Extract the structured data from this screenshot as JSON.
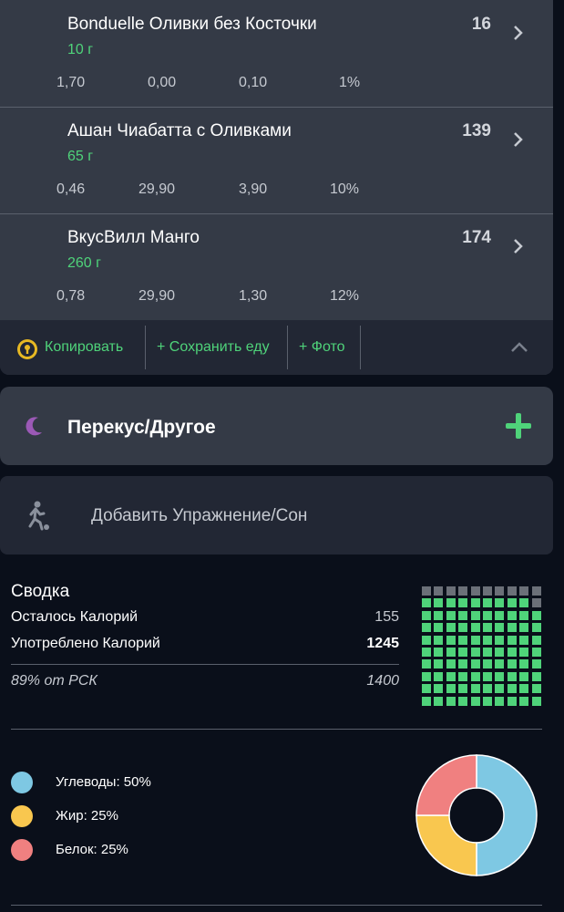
{
  "foods": [
    {
      "name": "Bonduelle Оливки без Косточки",
      "qty": "10 г",
      "kcal": "16",
      "n1": "1,70",
      "n2": "0,00",
      "n3": "0,10",
      "pct": "1%"
    },
    {
      "name": "Ашан Чиабатта с Оливками",
      "qty": "65 г",
      "kcal": "139",
      "n1": "0,46",
      "n2": "29,90",
      "n3": "3,90",
      "pct": "10%"
    },
    {
      "name": "ВкусВилл Манго",
      "qty": "260 г",
      "kcal": "174",
      "n1": "0,78",
      "n2": "29,90",
      "n3": "1,30",
      "pct": "12%"
    }
  ],
  "toolbar": {
    "copy_label": "Копировать",
    "save_meal_label": "+ Сохранить еду",
    "photo_label": "+ Фото",
    "icons": {
      "copy": "gold-coin-icon",
      "collapse": "chevron-up-icon"
    }
  },
  "snack": {
    "title": "Перекус/Другое",
    "icon": "moon-icon",
    "add_icon": "plus-icon"
  },
  "exercise": {
    "label": "Добавить Упражнение/Сон",
    "icon": "running-person-icon"
  },
  "summary": {
    "title": "Сводка",
    "remaining_label": "Осталось Калорий",
    "remaining_value": "155",
    "consumed_label": "Употреблено Калорий",
    "consumed_value": "1245",
    "percent_label": "89% от РСК",
    "target_value": "1400",
    "waffle_filled_fraction": 0.89
  },
  "macros": {
    "items": [
      {
        "label": "Углеводы: 50%",
        "value": 50,
        "color": "#7ec8e3"
      },
      {
        "label": "Жир: 25%",
        "value": 25,
        "color": "#f9c74f"
      },
      {
        "label": "Белок: 25%",
        "value": 25,
        "color": "#f08080"
      }
    ]
  },
  "colors": {
    "accent": "#4fd37a",
    "card": "#343a46",
    "background": "#0a0f1a",
    "moon": "#9b59b6"
  }
}
